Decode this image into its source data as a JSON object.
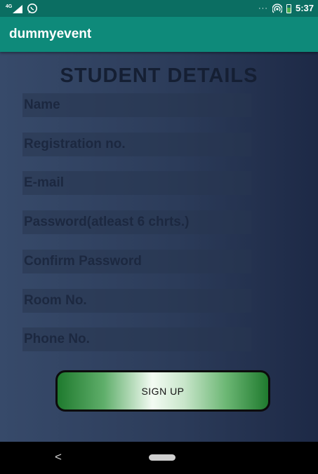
{
  "status_bar": {
    "network_label": "4G",
    "clock": "5:37",
    "more_dots": "···",
    "battery_level": 0.6,
    "icons": [
      "signal-icon",
      "whatsapp-icon",
      "hotspot-icon",
      "battery-icon"
    ]
  },
  "app_bar": {
    "title": "dummyevent"
  },
  "form": {
    "heading": "STUDENT DETAILS",
    "fields": [
      {
        "placeholder": "Name"
      },
      {
        "placeholder": "Registration no."
      },
      {
        "placeholder": "E-mail"
      },
      {
        "placeholder": "Password(atleast 6 chrts.)"
      },
      {
        "placeholder": "Confirm Password"
      },
      {
        "placeholder": "Room No."
      },
      {
        "placeholder": "Phone No."
      }
    ],
    "signup_label": "SIGN UP"
  },
  "nav_bar": {
    "back_glyph": "<",
    "icons": [
      "back-icon",
      "home-pill-icon"
    ]
  },
  "colors": {
    "status_bar": "#0b6e62",
    "app_bar": "#0e8a7a",
    "background_left": "#374a6a",
    "background_right": "#1d2946",
    "button_green": "#1f7a2e"
  }
}
